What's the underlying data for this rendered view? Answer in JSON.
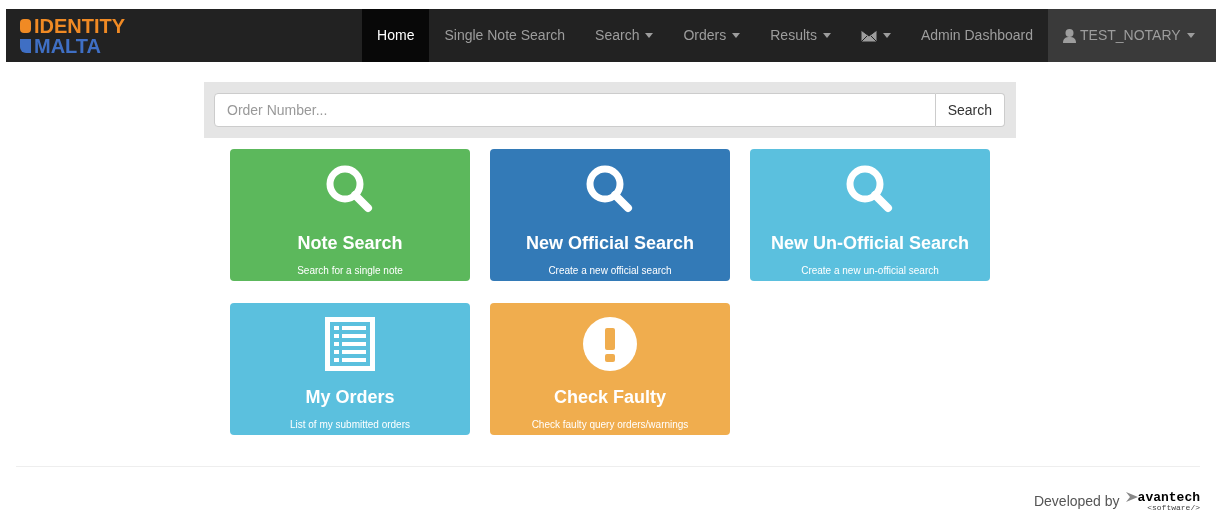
{
  "logo": {
    "line_1": "IDENTITY",
    "line_2": "MALTA"
  },
  "nav": [
    {
      "kind": "link",
      "label": "Home",
      "selected": true
    },
    {
      "kind": "link",
      "label": "Single Note Search",
      "selected": false
    },
    {
      "kind": "dropdown",
      "label": "Search",
      "selected": false
    },
    {
      "kind": "dropdown",
      "label": "Orders",
      "selected": false
    },
    {
      "kind": "dropdown",
      "label": "Results",
      "selected": false
    },
    {
      "kind": "mail",
      "selected": false
    },
    {
      "kind": "link",
      "label": "Admin Dashboard",
      "selected": false
    }
  ],
  "user_menu": {
    "label": "TEST_NOTARY"
  },
  "order_search": {
    "placeholder": "Order Number...",
    "button": "Search"
  },
  "tiles": [
    {
      "kind": "search",
      "title": "Note Search",
      "subtitle": "Search for a single note",
      "color": "#5cb85c"
    },
    {
      "kind": "search",
      "title": "New Official Search",
      "subtitle": "Create a new official search",
      "color": "#337ab7"
    },
    {
      "kind": "search",
      "title": "New Un-Official Search",
      "subtitle": "Create a new un-official search",
      "color": "#5bc0de"
    },
    {
      "kind": "list",
      "title": "My Orders",
      "subtitle": "List of my submitted orders",
      "color": "#5bc0de"
    },
    {
      "kind": "alert",
      "title": "Check Faulty",
      "subtitle": "Check faulty query orders/warnings",
      "color": "#f0ad4e"
    }
  ],
  "footer": {
    "text": "Developed by",
    "brand": "avantech",
    "brand_sub": "<software/>"
  }
}
